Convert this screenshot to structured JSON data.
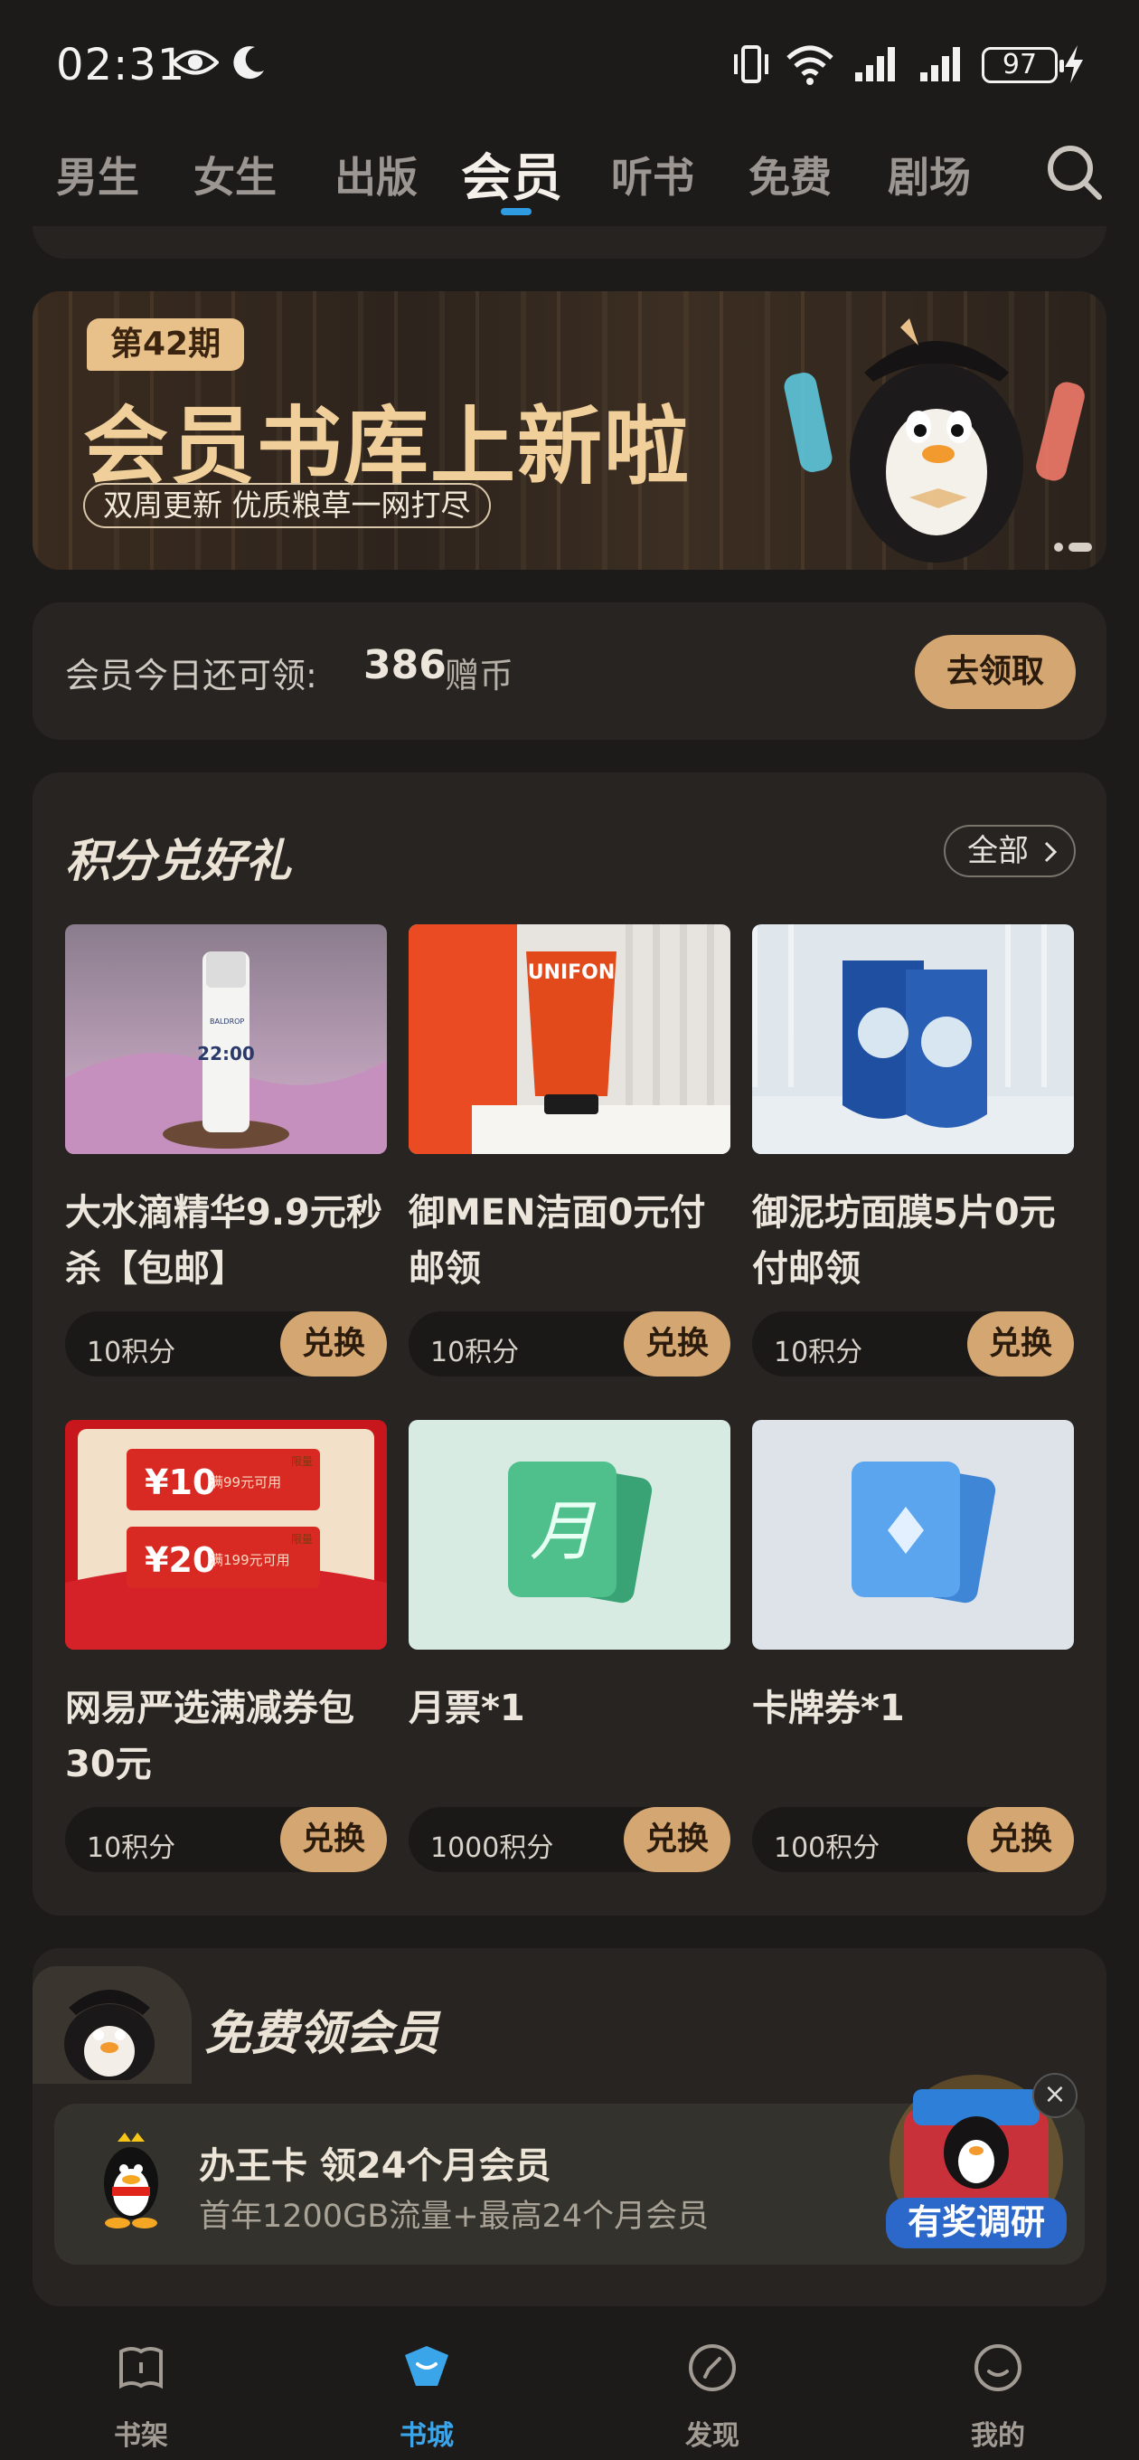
{
  "status_bar": {
    "time": "02:31",
    "battery": "97",
    "icons": [
      "eye-icon",
      "moon-icon",
      "vibrate-icon",
      "wifi-icon",
      "signal-icon",
      "signal-icon",
      "charging-icon"
    ]
  },
  "top_nav": {
    "tabs": [
      {
        "label": "男生"
      },
      {
        "label": "女生"
      },
      {
        "label": "出版"
      },
      {
        "label": "会员",
        "active": true
      },
      {
        "label": "听书"
      },
      {
        "label": "免费"
      },
      {
        "label": "剧场"
      }
    ],
    "search_icon": "search-icon",
    "active_color": "#2f9be0"
  },
  "banner": {
    "issue": "第42期",
    "title": "会员书库上新啦",
    "subtitle": "双周更新  优质粮草一网打尽"
  },
  "coins": {
    "label": "会员今日还可领:",
    "value": "386",
    "unit": "赠币",
    "button": "去领取"
  },
  "points": {
    "title": "积分兑好礼",
    "all_button": "全部",
    "items": [
      {
        "name": "大水滴精华9.9元秒杀【包邮】",
        "points": "10积分",
        "button": "兑换"
      },
      {
        "name": "御MEN洁面0元付邮领",
        "points": "10积分",
        "button": "兑换"
      },
      {
        "name": "御泥坊面膜5片0元付邮领",
        "points": "10积分",
        "button": "兑换"
      },
      {
        "name": "网易严选满减券包30元",
        "points": "10积分",
        "button": "兑换"
      },
      {
        "name": "月票*1",
        "points": "1000积分",
        "button": "兑换"
      },
      {
        "name": "卡牌券*1",
        "points": "100积分",
        "button": "兑换"
      }
    ],
    "image_texts": {
      "bottle": "22:00",
      "bottle_brand": "BALDROP",
      "tube": "UNIFON",
      "coupon1_amount": "10",
      "coupon1_cond": "满99元可用",
      "coupon2_amount": "20",
      "coupon2_cond": "满199元可用",
      "coupon_tag": "限量",
      "ticket_char": "月"
    },
    "accent": "#d4a671"
  },
  "free_member": {
    "title": "免费领会员",
    "promo_title": "办王卡 领24个月会员",
    "promo_sub": "首年1200GB流量+最高24个月会员",
    "survey_label": "有奖调研",
    "close": "×"
  },
  "tab_bar": {
    "items": [
      {
        "label": "书架",
        "icon": "bookshelf-icon"
      },
      {
        "label": "书城",
        "icon": "bookstore-icon",
        "active": true
      },
      {
        "label": "发现",
        "icon": "compass-icon"
      },
      {
        "label": "我的",
        "icon": "profile-icon"
      }
    ],
    "active_color": "#3ba5ea"
  }
}
